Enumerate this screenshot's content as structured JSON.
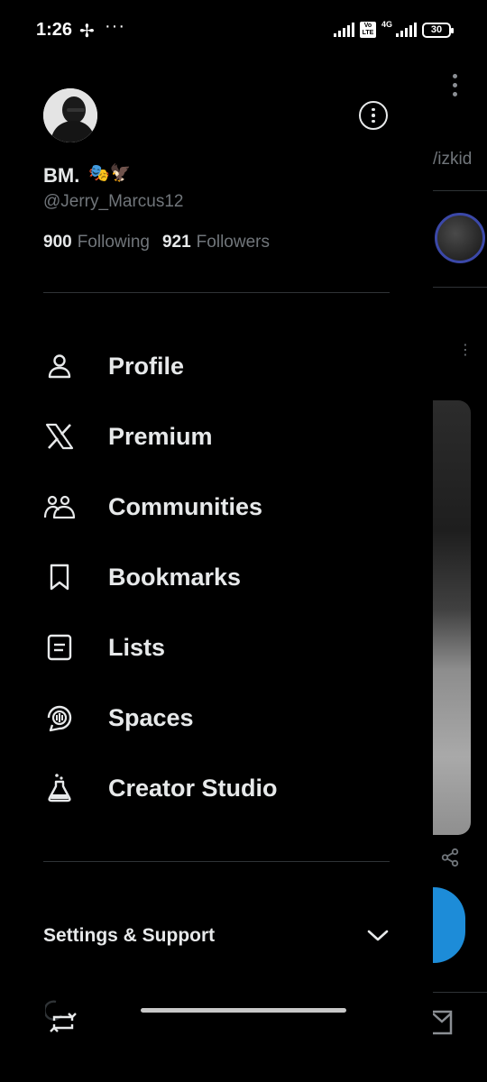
{
  "status_bar": {
    "time": "1:26",
    "fan_glyph": "✢",
    "dots": "···",
    "volte": "Vo LTE",
    "network": "4G",
    "battery": "30"
  },
  "profile": {
    "display_name": "BM.",
    "name_emojis": "🎭🦅",
    "handle": "@Jerry_Marcus12",
    "following_count": "900",
    "following_label": "Following",
    "followers_count": "921",
    "followers_label": "Followers"
  },
  "menu": [
    {
      "label": "Profile",
      "icon": "person-icon"
    },
    {
      "label": "Premium",
      "icon": "x-logo-icon"
    },
    {
      "label": "Communities",
      "icon": "communities-icon"
    },
    {
      "label": "Bookmarks",
      "icon": "bookmark-icon"
    },
    {
      "label": "Lists",
      "icon": "list-icon"
    },
    {
      "label": "Spaces",
      "icon": "spaces-icon"
    },
    {
      "label": "Creator Studio",
      "icon": "flask-icon"
    }
  ],
  "settings": {
    "label": "Settings & Support"
  },
  "feed_peek": {
    "text": "/izkid"
  },
  "colors": {
    "background": "#000000",
    "text": "#e7e9ea",
    "muted": "#71767b",
    "divider": "#2f3336",
    "accent": "#1d8cd8"
  }
}
